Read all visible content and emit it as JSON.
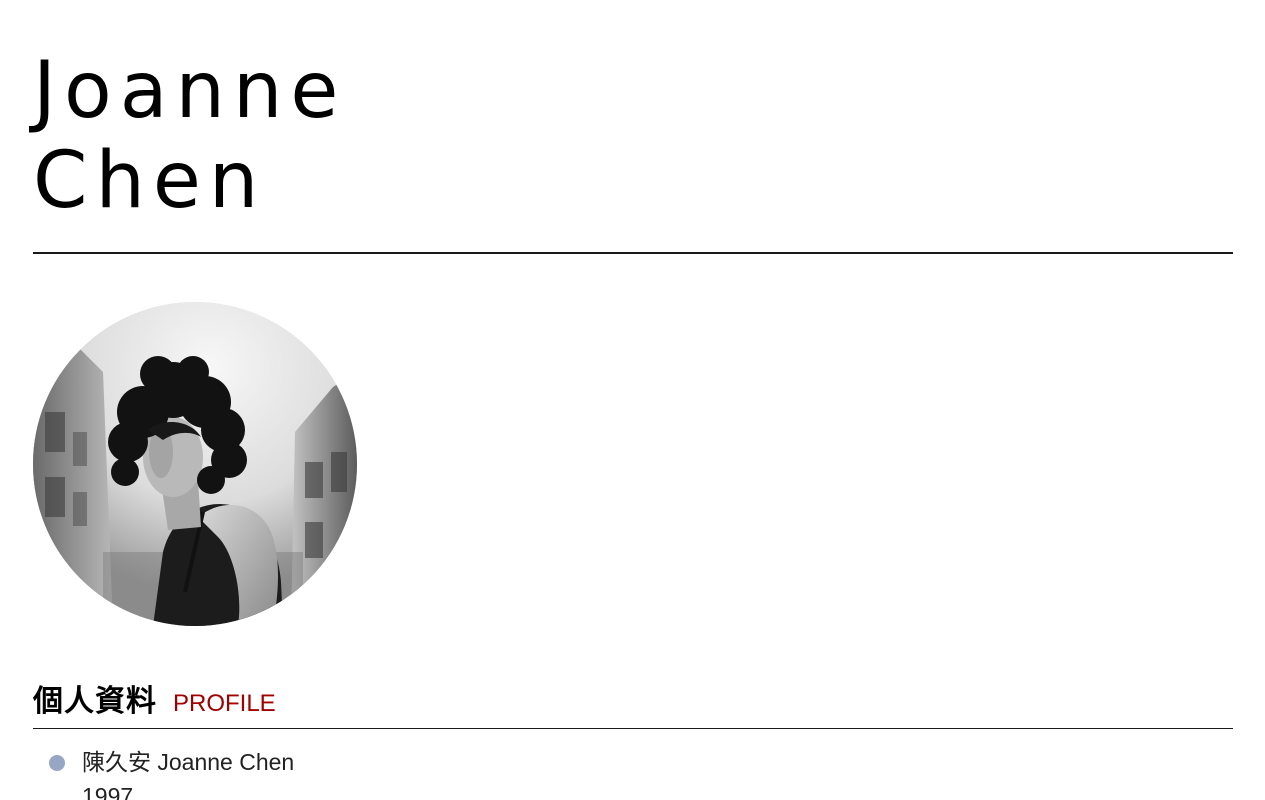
{
  "header": {
    "first_name": "Joanne",
    "last_name": "Chen"
  },
  "avatar": {
    "alt": "Black and white portrait photo"
  },
  "profile_section": {
    "title_zh": "個人資料",
    "title_en": "PROFILE",
    "items": [
      {
        "name": "陳久安 Joanne Chen",
        "year": "1997"
      }
    ]
  },
  "colors": {
    "accent": "#a00000",
    "bullet": "#97a6c4",
    "rule": "#1a1a1a"
  },
  "icons": {
    "bullet": "bullet-dot-icon"
  }
}
